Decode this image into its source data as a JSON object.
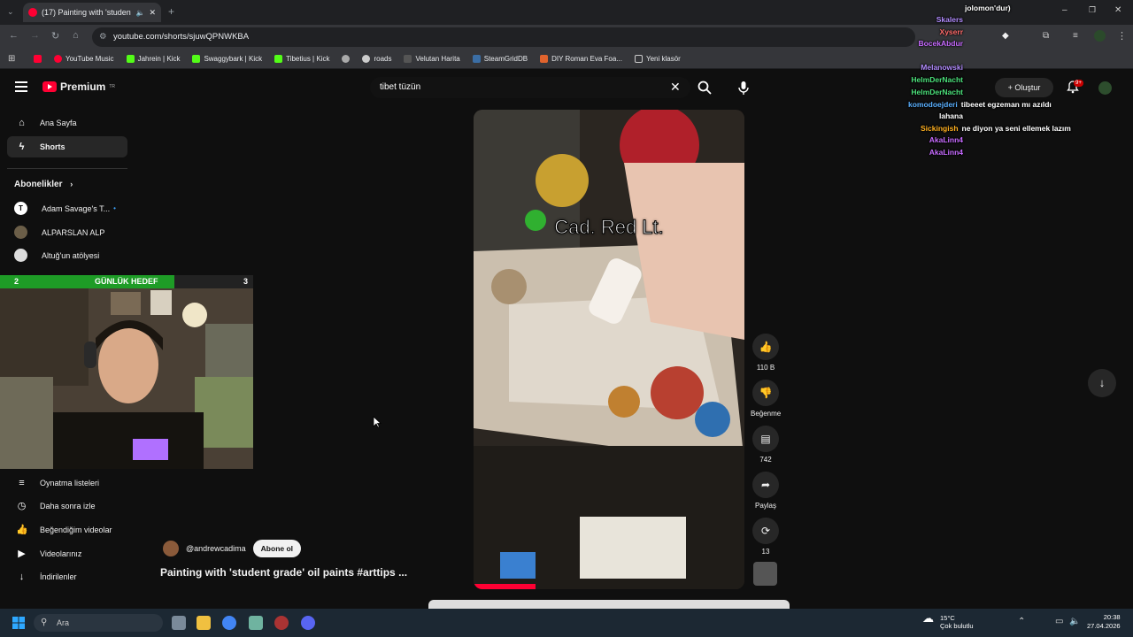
{
  "browser": {
    "tab_title": "(17) Painting with 'student",
    "url": "youtube.com/shorts/sjuwQPNWKBA",
    "bookmarks": [
      "YouTube Music",
      "Jahrein | Kick",
      "Swaggybark | Kick",
      "Tibetius | Kick",
      "roads",
      "Velutan Harita",
      "SteamGridDB",
      "DIY Roman Eva Foa...",
      "Yeni klasör"
    ]
  },
  "youtube": {
    "logo": "Premium",
    "logo_sup": "TR",
    "search_value": "tibet tüzün",
    "create_label": "Oluştur",
    "notif_badge": "9+",
    "nav": [
      "Ana Sayfa",
      "Shorts"
    ],
    "subs_title": "Abonelikler",
    "subscriptions": [
      "Adam Savage's T...",
      "ALPARSLAN ALP",
      "Altuğ'un atölyesi"
    ],
    "you_items": [
      "Oynatma listeleri",
      "Daha sonra izle",
      "Beğendiğim videolar",
      "Videolarınız",
      "İndirilenler"
    ]
  },
  "goal": {
    "left": "2",
    "label": "GÜNLÜK HEDEF",
    "right": "3",
    "progress": 0.69
  },
  "short": {
    "caption": "Cad. Red Lt.",
    "likes": "110 B",
    "dislike_label": "Beğenme",
    "comments": "742",
    "share_label": "Paylaş",
    "remix_count": "13",
    "channel": "@andrewcadima",
    "subscribe_label": "Abone ol",
    "title": "Painting with 'student grade' oil paints #arttips  ..."
  },
  "chat": [
    {
      "user": "jolomon'dur)",
      "msg": "",
      "color": "#ffffff"
    },
    {
      "user": "Skalers",
      "msg": "",
      "color": "#b28cff"
    },
    {
      "user": "Xyserr",
      "msg": "",
      "color": "#ff6b6b"
    },
    {
      "user": "BocekAbdur",
      "msg": "",
      "color": "#c76bff"
    },
    {
      "user": "",
      "msg": "",
      "color": "#ff3b3b"
    },
    {
      "user": "Melanowski",
      "msg": "",
      "color": "#b28cff"
    },
    {
      "user": "HelmDerNacht",
      "msg": "",
      "color": "#4be07a"
    },
    {
      "user": "HelmDerNacht",
      "msg": "",
      "color": "#4be07a"
    },
    {
      "user": "komodoejderi",
      "msg": "tibeeet egzeman mı azıldı",
      "color": "#5ab0ff"
    },
    {
      "user": "",
      "msg": "lahana",
      "color": "#ffffff"
    },
    {
      "user": "Sickingish",
      "msg": "ne diyon ya seni ellemek lazım",
      "color": "#ffb020"
    },
    {
      "user": "AkaLinn4",
      "msg": "",
      "color": "#c76bff"
    },
    {
      "user": "AkaLinn4",
      "msg": "",
      "color": "#c76bff"
    }
  ],
  "taskbar": {
    "search_placeholder": "Ara",
    "weather_temp": "15°C",
    "weather_desc": "Çok bulutlu",
    "time": "20:38",
    "date": "27.04.2026"
  },
  "colors": {
    "accent_red": "#ff0033",
    "goal_green": "#1e9c26",
    "bg": "#0f0f0f"
  }
}
